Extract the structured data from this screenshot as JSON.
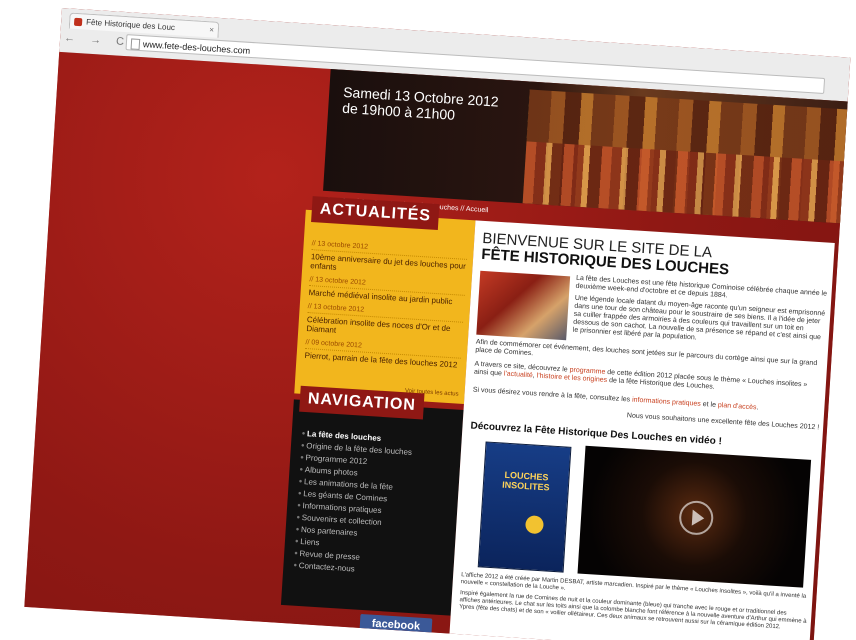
{
  "browser": {
    "tab_title": "Fête Historique des Louc",
    "tab_close": "×",
    "nav_glyphs": "← → C",
    "url": "www.fete-des-louches.com"
  },
  "banner": {
    "date_line1": "Samedi 13 Octobre 2012",
    "date_line2": "de 19h00 à 21h00"
  },
  "breadcrumb": "Vous êtes ici : Fête Historique des Louches // Accueil",
  "actualites": {
    "title": "ACTUALITÉS",
    "items": [
      {
        "date": "// 13 octobre 2012",
        "text": "10ème anniversaire du jet des louches pour enfants"
      },
      {
        "date": "// 13 octobre 2012",
        "text": "Marché médiéval insolite au jardin public"
      },
      {
        "date": "// 13 octobre 2012",
        "text": "Célébration insolite des noces d'Or et de Diamant"
      },
      {
        "date": "// 09 octobre 2012",
        "text": "Pierrot, parrain de la fête des louches 2012"
      }
    ],
    "more": "Voir toutes les actus"
  },
  "navigation": {
    "title": "NAVIGATION",
    "items": [
      "La fête des louches",
      "Origine de la fête des louches",
      "Programme 2012",
      "Albums photos",
      "Les animations de la fête",
      "Les géants de Comines",
      "Informations pratiques",
      "Souvenirs et collection",
      "Nos partenaires",
      "Liens",
      "Revue de presse",
      "Contactez-nous"
    ]
  },
  "facebook": "facebook",
  "main": {
    "heading1": "BIENVENUE SUR LE SITE DE LA",
    "heading2": "FÊTE HISTORIQUE DES LOUCHES",
    "p1": "La fête des Louches est une fête historique Cominoise célébrée chaque année le deuxième week-end d'octobre et ce depuis 1884.",
    "p2": "Une légende locale datant du moyen-âge raconte qu'un seigneur est emprisonné dans une tour de son château pour le soustraire de ses biens. Il a l'idée de jeter sa cuiller frappée des armoiries à des couleurs qui travaillent sur un toit en dessous de son cachot. La nouvelle de sa présence se répand et c'est ainsi que le prisonnier est libéré par la population.",
    "p3": "Afin de commémorer cet événement, des louches sont jetées sur le parcours du cortège ainsi que sur la grand place de Comines.",
    "p4_a": "A travers ce site, découvrez le ",
    "p4_link1": "programme",
    "p4_b": " de cette édition 2012 placée sous le thème « Louches insolites » ainsi que ",
    "p4_link2": "l'actualité",
    "p4_c": ", ",
    "p4_link3": "l'histoire et les origines",
    "p4_d": " de la fête Historique des Louches.",
    "p5_a": "Si vous désirez vous rendre à la fête, consultez les ",
    "p5_link1": "informations pratiques",
    "p5_b": " et le ",
    "p5_link2": "plan d'accès",
    "p5_c": ".",
    "p6": "Nous vous souhaitons une excellente fête des Louches 2012 !",
    "video_title": "Découvrez la Fête Historique Des Louches en vidéo !",
    "poster_title": "LOUCHES INSOLITES",
    "caption1": "L'affiche 2012 a été créée par Martin DESBAT, artiste marcadien. Inspiré par le thème « Louches insolites », voilà qu'il a inventé la nouvelle « constellation de la Louche ».",
    "caption2": "Inspiré également la rue de Comines de nuit et la couleur dominante (bleue) qui tranche avec le rouge et or traditionnel des affiches antérieures. Le chat sur les toits ainsi que la colombe blanche font référence à la nouvelle aventure d'Arthur qui emmène à Ypres (fête des chats) et de son « voilier ollétaireur. Ces deux animaux se retrouvent aussi sur la céramique édition 2012."
  }
}
